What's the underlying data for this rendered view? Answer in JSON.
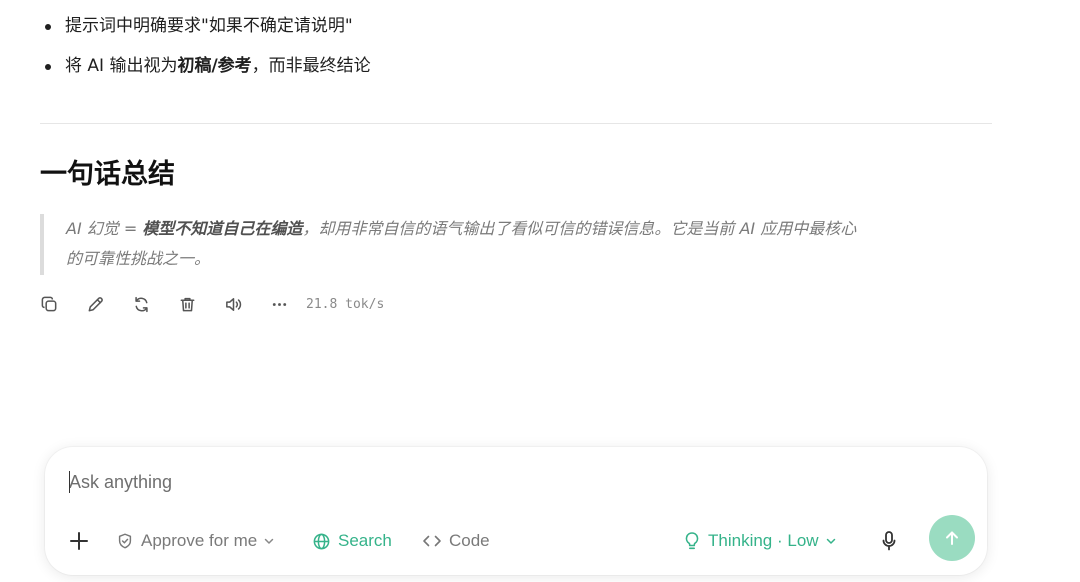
{
  "message": {
    "bullets": [
      {
        "text": "提示词中明确要求\"如果不确定请说明\""
      },
      {
        "prefix": "将 AI 输出视为",
        "bold": "初稿/参考",
        "suffix": "，而非最终结论"
      }
    ],
    "summary_heading": "一句话总结",
    "quote": {
      "line1_prefix": "AI 幻觉 = ",
      "line1_bold": "模型不知道自己在编造",
      "line1_suffix": "，却用非常自信的语气输出了看似可信的错误信息。它是当前 AI 应用中最核心",
      "line2": "的可靠性挑战之一。"
    },
    "actions": {
      "icons": [
        "copy-icon",
        "edit-icon",
        "regenerate-icon",
        "delete-icon",
        "speaker-icon",
        "more-icon"
      ],
      "speed": "21.8 tok/s"
    }
  },
  "composer": {
    "placeholder": "Ask anything",
    "add_icon": "plus-icon",
    "approve_label": "Approve for me",
    "search_label": "Search",
    "code_label": "Code",
    "thinking_label": "Thinking · Low",
    "mic_icon": "microphone-icon",
    "send_icon": "arrow-up-icon"
  },
  "colors": {
    "accent": "#35b38a",
    "send_button": "#9adcc1",
    "quote_text": "#7a7a7a"
  }
}
